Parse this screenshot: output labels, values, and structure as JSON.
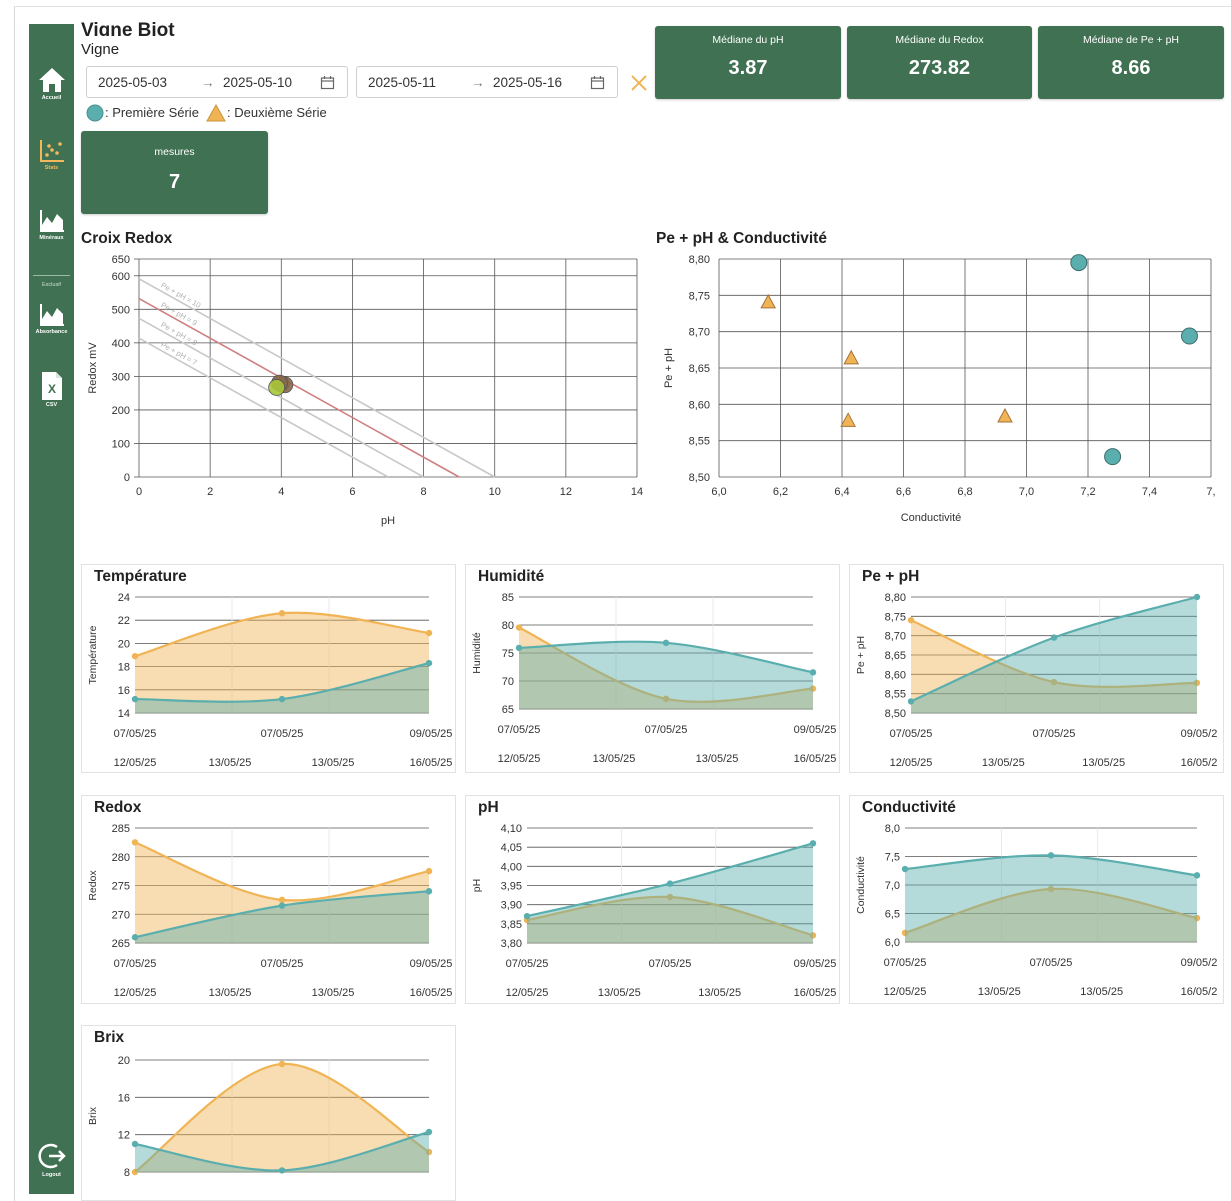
{
  "header": {
    "title": "Vigne Biot",
    "subtitle": "Vigne",
    "range1": {
      "start": "2025-05-03",
      "end": "2025-05-10"
    },
    "range2": {
      "start": "2025-05-11",
      "end": "2025-05-16"
    },
    "arrow": "→",
    "legend": {
      "series1": ": Première Série",
      "series2": ": Deuxième Série"
    }
  },
  "sidebar": {
    "items": [
      {
        "label": "Accueil",
        "icon": "home-icon"
      },
      {
        "label": "Stats",
        "icon": "scatter-chart-icon"
      },
      {
        "label": "Minéraux",
        "icon": "area-chart-icon"
      },
      {
        "label": "Absorbance",
        "icon": "area-chart-icon"
      },
      {
        "label": "CSV",
        "icon": "excel-file-icon"
      }
    ],
    "section_label": "Exclusif",
    "logout_label": "Logout"
  },
  "kpis": [
    {
      "label": "Médiane du pH",
      "value": "3.87"
    },
    {
      "label": "Médiane du Redox",
      "value": "273.82"
    },
    {
      "label": "Médiane de Pe + pH",
      "value": "8.66"
    }
  ],
  "measures": {
    "label": "mesures",
    "value": "7"
  },
  "colors": {
    "brand": "#3f7152",
    "series1": "#5aaeae",
    "series2": "#f0b455",
    "accent": "#f1b95c"
  },
  "chart_data": [
    {
      "id": "croix-redox",
      "type": "scatter",
      "title": "Croix Redox",
      "xlabel": "pH",
      "ylabel": "Redox mV",
      "xlim": [
        0,
        14
      ],
      "ylim": [
        0,
        650
      ],
      "xticks": [
        0,
        2,
        4,
        6,
        8,
        10,
        12,
        14
      ],
      "yticks": [
        0,
        100,
        200,
        300,
        400,
        500,
        600,
        650
      ],
      "grid": true,
      "reference_lines": [
        {
          "label": "Pe + pH = 10",
          "x": [
            0,
            10
          ],
          "y": [
            591,
            0
          ],
          "color": "#c8c8c8"
        },
        {
          "label": "Pe + pH = 9",
          "x": [
            0,
            9
          ],
          "y": [
            532,
            0
          ],
          "color": "#d08080"
        },
        {
          "label": "Pe + pH = 8",
          "x": [
            0,
            8
          ],
          "y": [
            473,
            0
          ],
          "color": "#c8c8c8"
        },
        {
          "label": "Pe + pH = 7",
          "x": [
            0,
            7
          ],
          "y": [
            414,
            0
          ],
          "color": "#c8c8c8"
        }
      ],
      "series": [
        {
          "name": "Première Série",
          "points": [
            [
              4.0,
              278
            ],
            [
              4.1,
              275
            ],
            [
              3.95,
              280
            ]
          ],
          "color": "#8a6a4a"
        },
        {
          "name": "Deuxième Série",
          "points": [
            [
              3.87,
              267
            ]
          ],
          "color": "#a8c53a"
        }
      ]
    },
    {
      "id": "pe-ph-conductivite",
      "type": "scatter",
      "title": "Pe + pH & Conductivité",
      "xlabel": "Conductivité",
      "ylabel": "Pe + pH",
      "xlim": [
        6.0,
        7.6
      ],
      "ylim": [
        8.5,
        8.8
      ],
      "xticks": [
        "6,0",
        "6,2",
        "6,4",
        "6,6",
        "6,8",
        "7,0",
        "7,2",
        "7,4",
        "7,"
      ],
      "yticks": [
        "8,50",
        "8,55",
        "8,60",
        "8,65",
        "8,70",
        "8,75",
        "8,80"
      ],
      "grid": true,
      "series": [
        {
          "name": "Première Série",
          "marker": "circle",
          "x": [
            7.17,
            7.53,
            7.28
          ],
          "y": [
            8.795,
            8.694,
            8.528
          ]
        },
        {
          "name": "Deuxième Série",
          "marker": "triangle",
          "x": [
            6.16,
            6.43,
            6.42,
            6.93
          ],
          "y": [
            8.741,
            8.664,
            8.578,
            8.584
          ]
        }
      ]
    },
    {
      "id": "temperature",
      "type": "area",
      "title": "Température",
      "ylabel": "Température",
      "ylim": [
        14,
        24
      ],
      "yticks": [
        "14",
        "16",
        "18",
        "20",
        "22",
        "24"
      ],
      "top_ticks": [
        "07/05/25",
        "07/05/25",
        "09/05/25"
      ],
      "bottom_ticks": [
        "12/05/25",
        "13/05/25",
        "13/05/25",
        "16/05/25"
      ],
      "series": [
        {
          "name": "Première Série",
          "values": [
            15.2,
            15.2,
            18.3
          ]
        },
        {
          "name": "Deuxième Série",
          "values": [
            18.9,
            22.6,
            20.9
          ]
        }
      ]
    },
    {
      "id": "humidite",
      "type": "area",
      "title": "Humidité",
      "ylabel": "Humidité",
      "ylim": [
        63,
        85
      ],
      "yticks": [
        "65",
        "70",
        "75",
        "80",
        "85"
      ],
      "top_ticks": [
        "07/05/25",
        "07/05/25",
        "09/05/25"
      ],
      "bottom_ticks": [
        "12/05/25",
        "13/05/25",
        "13/05/25",
        "16/05/25"
      ],
      "series": [
        {
          "name": "Première Série",
          "values": [
            75.0,
            76.0,
            70.2
          ]
        },
        {
          "name": "Deuxième Série",
          "values": [
            79.0,
            65.0,
            67.0
          ]
        }
      ]
    },
    {
      "id": "pe-ph",
      "type": "area",
      "title": "Pe + pH",
      "ylabel": "Pe + pH",
      "ylim": [
        8.5,
        8.8
      ],
      "yticks": [
        "8,50",
        "8,55",
        "8,60",
        "8,65",
        "8,70",
        "8,75",
        "8,80"
      ],
      "top_ticks": [
        "07/05/25",
        "07/05/25",
        "09/05/2"
      ],
      "bottom_ticks": [
        "12/05/25",
        "13/05/25",
        "13/05/25",
        "16/05/2"
      ],
      "series": [
        {
          "name": "Première Série",
          "values": [
            8.53,
            8.695,
            8.8
          ]
        },
        {
          "name": "Deuxième Série",
          "values": [
            8.74,
            8.58,
            8.578
          ]
        }
      ]
    },
    {
      "id": "redox",
      "type": "area",
      "title": "Redox",
      "ylabel": "Redox",
      "ylim": [
        265,
        285
      ],
      "yticks": [
        "265",
        "270",
        "275",
        "280",
        "285"
      ],
      "top_ticks": [
        "07/05/25",
        "07/05/25",
        "09/05/25"
      ],
      "bottom_ticks": [
        "12/05/25",
        "13/05/25",
        "13/05/25",
        "16/05/25"
      ],
      "series": [
        {
          "name": "Première Série",
          "values": [
            266,
            271.5,
            274
          ]
        },
        {
          "name": "Deuxième Série",
          "values": [
            282.5,
            272.5,
            277.5
          ]
        }
      ]
    },
    {
      "id": "ph",
      "type": "area",
      "title": "pH",
      "ylabel": "pH",
      "ylim": [
        3.8,
        4.1
      ],
      "yticks": [
        "3,80",
        "3,85",
        "3,90",
        "3,95",
        "4,00",
        "4,05",
        "4,10"
      ],
      "top_ticks": [
        "07/05/25",
        "07/05/25",
        "09/05/25"
      ],
      "bottom_ticks": [
        "12/05/25",
        "13/05/25",
        "13/05/25",
        "16/05/25"
      ],
      "series": [
        {
          "name": "Première Série",
          "values": [
            3.87,
            3.955,
            4.06
          ]
        },
        {
          "name": "Deuxième Série",
          "values": [
            3.86,
            3.92,
            3.82
          ]
        }
      ]
    },
    {
      "id": "conductivite",
      "type": "area",
      "title": "Conductivité",
      "ylabel": "Conductivité",
      "ylim": [
        6.0,
        8.0
      ],
      "yticks": [
        "6,0",
        "6,5",
        "7,0",
        "7,5",
        "8,0"
      ],
      "top_ticks": [
        "07/05/25",
        "07/05/25",
        "09/05/2"
      ],
      "bottom_ticks": [
        "12/05/25",
        "13/05/25",
        "13/05/25",
        "16/05/2"
      ],
      "series": [
        {
          "name": "Première Série",
          "values": [
            7.28,
            7.52,
            7.17
          ]
        },
        {
          "name": "Deuxième Série",
          "values": [
            6.16,
            6.93,
            6.42
          ]
        }
      ]
    },
    {
      "id": "brix",
      "type": "area",
      "title": "Brix",
      "ylabel": "Brix",
      "ylim": [
        8,
        22
      ],
      "yticks": [
        "8",
        "12",
        "16",
        "20"
      ],
      "top_ticks": [],
      "bottom_ticks": [],
      "series": [
        {
          "name": "Première Série",
          "values": [
            11.5,
            8.2,
            13.0
          ]
        },
        {
          "name": "Deuxième Série",
          "values": [
            8.0,
            21.5,
            10.5
          ]
        }
      ]
    }
  ]
}
